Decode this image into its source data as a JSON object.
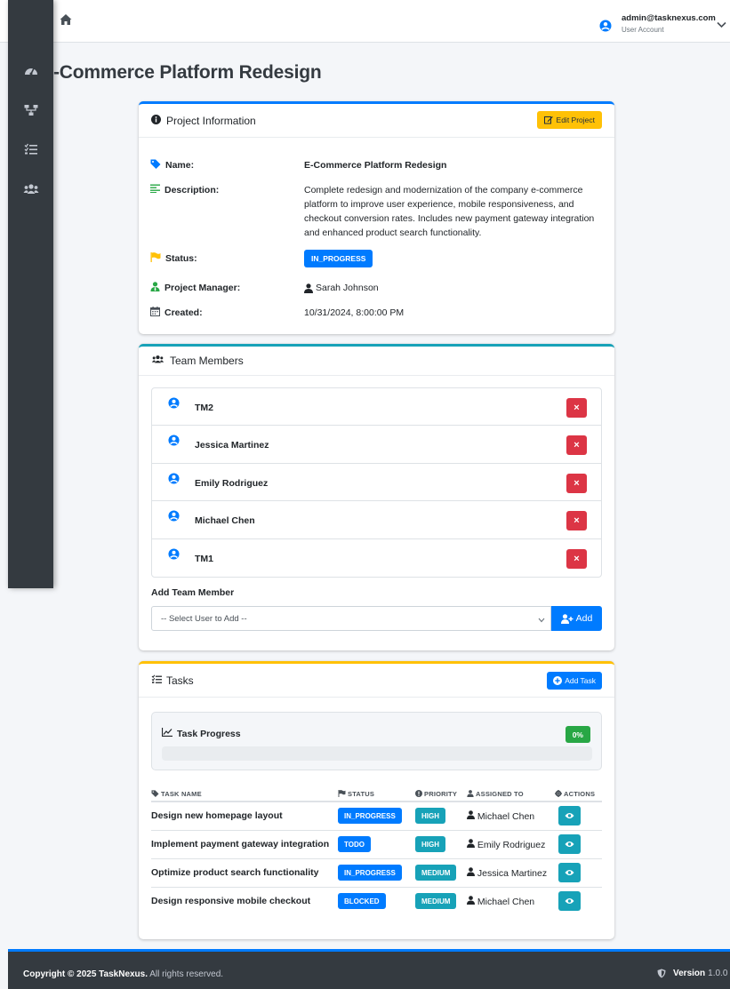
{
  "header": {
    "user_email": "admin@tasknexus.com",
    "user_role": "User Account"
  },
  "page": {
    "title": "-Commerce Platform Redesign"
  },
  "project_info": {
    "card_title": "Project Information",
    "edit_label": "Edit Project",
    "labels": {
      "name": "Name:",
      "description": "Description:",
      "status": "Status:",
      "manager": "Project Manager:",
      "created": "Created:"
    },
    "name": "E-Commerce Platform Redesign",
    "description": "Complete redesign and modernization of the company e-commerce platform to improve user experience, mobile responsiveness, and checkout conversion rates. Includes new payment gateway integration and enhanced product search functionality.",
    "status": "IN_PROGRESS",
    "manager": "Sarah Johnson",
    "created": "10/31/2024, 8:00:00 PM"
  },
  "team": {
    "card_title": "Team Members",
    "members": [
      "TM2",
      "Jessica Martinez",
      "Emily Rodriguez",
      "Michael Chen",
      "TM1"
    ],
    "remove_symbol": "×",
    "add_label": "Add Team Member",
    "select_placeholder": "-- Select User to Add --",
    "add_button": "Add"
  },
  "tasks": {
    "card_title": "Tasks",
    "add_task_label": "Add Task",
    "progress_title": "Task Progress",
    "progress_text": "0%",
    "progress_value": 0,
    "columns": [
      "TASK NAME",
      "STATUS",
      "PRIORITY",
      "ASSIGNED TO",
      "ACTIONS"
    ],
    "rows": [
      {
        "name": "Design new homepage layout",
        "status": "IN_PROGRESS",
        "priority": "HIGH",
        "assignee": "Michael Chen"
      },
      {
        "name": "Implement payment gateway integration",
        "status": "TODO",
        "priority": "HIGH",
        "assignee": "Emily Rodriguez"
      },
      {
        "name": "Optimize product search functionality",
        "status": "IN_PROGRESS",
        "priority": "MEDIUM",
        "assignee": "Jessica Martinez"
      },
      {
        "name": "Design responsive mobile checkout",
        "status": "BLOCKED",
        "priority": "MEDIUM",
        "assignee": "Michael Chen"
      }
    ]
  },
  "footer": {
    "copyright": "Copyright © 2025 TaskNexus.",
    "rights": " All rights reserved.",
    "version_label": "Version",
    "version": "1.0.0"
  },
  "colors": {
    "primary": "#007bff",
    "info": "#17a2b8",
    "warning": "#ffc107",
    "danger": "#dc3545",
    "success": "#28a745",
    "sidebar": "#343a40"
  },
  "icons": [
    "home-icon",
    "user-circle-icon",
    "chevron-down-icon",
    "dashboard-icon",
    "project-diagram-icon",
    "tasks-icon",
    "users-icon",
    "info-circle-icon",
    "edit-icon",
    "tag-icon",
    "align-left-icon",
    "flag-icon",
    "user-tie-icon",
    "calendar-icon",
    "user-icon",
    "times-icon",
    "user-plus-icon",
    "plus-circle-icon",
    "chart-line-icon",
    "eye-icon",
    "shield-icon"
  ]
}
